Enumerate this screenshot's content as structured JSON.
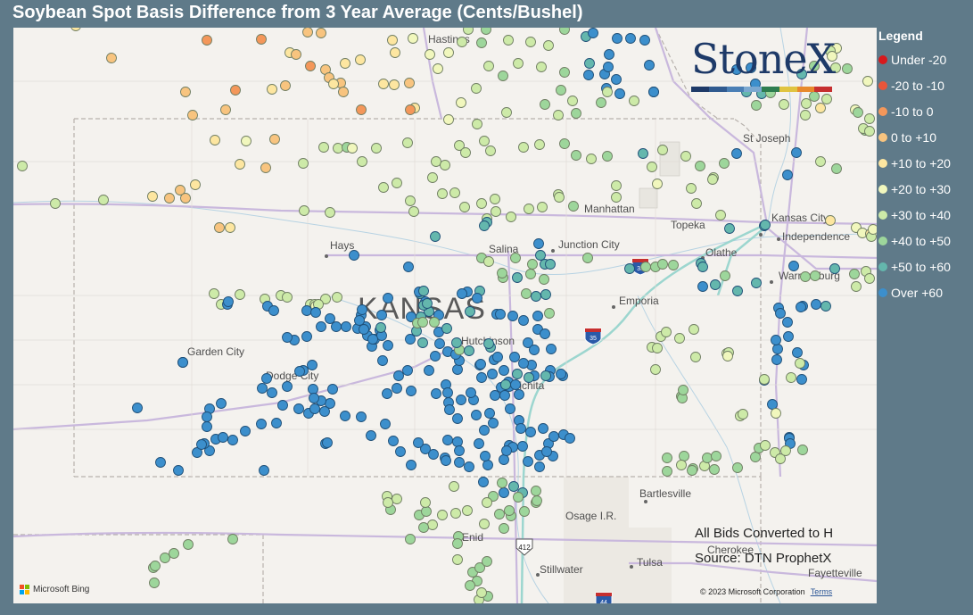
{
  "title": "Soybean Spot Basis Difference from 3 Year Average (Cents/Bushel)",
  "legend": {
    "title": "Legend",
    "items": [
      {
        "label": "Under -20",
        "color": "#d7191c"
      },
      {
        "label": "-20 to -10",
        "color": "#e8553a"
      },
      {
        "label": "-10 to 0",
        "color": "#f4975a"
      },
      {
        "label": "0 to +10",
        "color": "#f8c47f"
      },
      {
        "label": "+10 to +20",
        "color": "#fde6a0"
      },
      {
        "label": "+20 to +30",
        "color": "#f1f7bd"
      },
      {
        "label": "+30 to +40",
        "color": "#cdeaa8"
      },
      {
        "label": "+40 to +50",
        "color": "#9dd69b"
      },
      {
        "label": "+50 to +60",
        "color": "#64b7ad"
      },
      {
        "label": "Over +60",
        "color": "#3c8fcc"
      }
    ]
  },
  "logo": {
    "text": "StoneX",
    "bar_colors": [
      "#1e3a68",
      "#2f5a8f",
      "#4a7fb5",
      "#7ba8d0",
      "#2e7d4f",
      "#e0c440",
      "#e8892c",
      "#c62f2f"
    ]
  },
  "map": {
    "state_label": "KANSAS",
    "places": [
      "Hastings",
      "St Joseph",
      "Manhattan",
      "Topeka",
      "Kansas City",
      "Independence",
      "Hays",
      "Salina",
      "Junction City",
      "Olathe",
      "Emporia",
      "Warrensburg",
      "Hutchinson",
      "Garden City",
      "Dodge City",
      "Wichita",
      "Bartlesville",
      "Osage I.R.",
      "Enid",
      "Stillwater",
      "Tulsa",
      "Cherokee",
      "Fayetteville"
    ],
    "highways": [
      "35",
      "35",
      "412",
      "44"
    ]
  },
  "notes": {
    "bids": "All Bids Converted to H",
    "source": "Source: DTN ProphetX"
  },
  "attribution": {
    "bing": "Microsoft Bing",
    "copyright": "© 2023 Microsoft Corporation",
    "terms": "Terms"
  }
}
